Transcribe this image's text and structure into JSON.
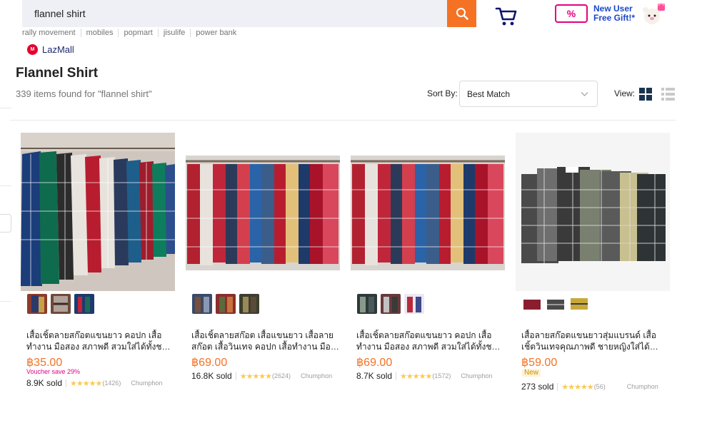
{
  "search": {
    "value": "flannel shirt",
    "button": "search-icon"
  },
  "promo": {
    "ticket": "%",
    "line1": "New User",
    "line2": "Free Gift!*"
  },
  "suggestions": [
    "rally movement",
    "mobiles",
    "popmart",
    "jisulife",
    "power bank"
  ],
  "lazmall": {
    "icon_text": "M",
    "label": "LazMall"
  },
  "page": {
    "title": "Flannel Shirt",
    "result_count": "339 items found for \"flannel shirt\""
  },
  "sort": {
    "label": "Sort By:",
    "selected": "Best Match"
  },
  "view": {
    "label": "View:"
  },
  "colors": {
    "accent": "#f57224",
    "brand_blue": "#1a2a6c",
    "voucher": "#e3007f",
    "star": "#faca51"
  },
  "products": [
    {
      "title": "เสื้อเชิ้ตลายสก๊อตแขนยาว คอปก เสื้อทำงาน มือสอง สภาพดี สวมใส่ได้ทั้งชาย หญิง",
      "price": "฿35.00",
      "voucher": "Voucher save 29%",
      "sold": "8.9K sold",
      "stars": "★★★★★",
      "reviews": "(1426)",
      "location": "Chumphon"
    },
    {
      "title": "เสื้อเชิ้ตลายสก๊อต เสื้อแขนยาว เสื้อลายสก๊อต เสื้อวินเทจ คอปก เสื้อทำงาน มือสอง",
      "price": "฿69.00",
      "sold": "16.8K sold",
      "stars": "★★★★★",
      "reviews": "(2624)",
      "location": "Chumphon"
    },
    {
      "title": "เสื้อเชิ้ตลายสก๊อตแขนยาว คอปก เสื้อทำงาน มือสอง สภาพดี สวมใส่ได้ทั้งชาย หญิง",
      "price": "฿69.00",
      "sold": "8.7K sold",
      "stars": "★★★★★",
      "reviews": "(1572)",
      "location": "Chumphon"
    },
    {
      "title": "เสื้อลายสก๊อตแขนยาวสุ่มแบรนด์ เสื้อเชิ้ตวินเทจคุณภาพดี ชายหญิงใส่ได้ ผู้ชาย ผู้หญิง",
      "price": "฿59.00",
      "badge": "New",
      "sold": "273 sold",
      "stars": "★★★★★",
      "reviews": "(56)",
      "location": "Chumphon"
    }
  ]
}
